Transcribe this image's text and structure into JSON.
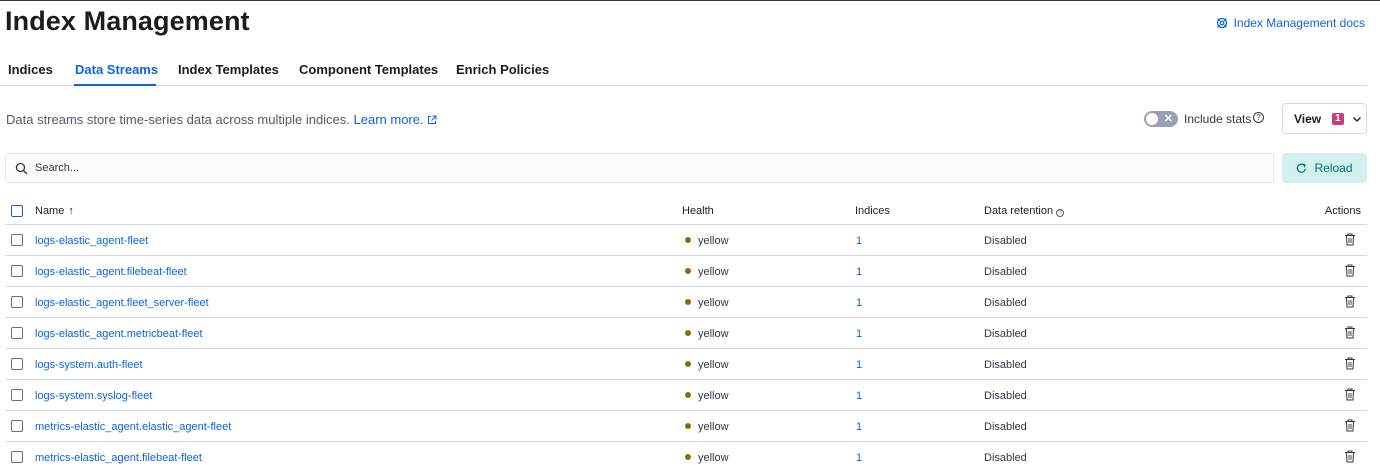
{
  "header": {
    "title": "Index Management",
    "docs_link": "Index Management docs"
  },
  "tabs": [
    {
      "label": "Indices",
      "active": false
    },
    {
      "label": "Data Streams",
      "active": true
    },
    {
      "label": "Index Templates",
      "active": false
    },
    {
      "label": "Component Templates",
      "active": false
    },
    {
      "label": "Enrich Policies",
      "active": false
    }
  ],
  "description": {
    "text": "Data streams store time-series data across multiple indices. ",
    "link": "Learn more."
  },
  "controls": {
    "include_stats_label": "Include stats",
    "include_stats_on": false,
    "view_label": "View",
    "view_badge": "1",
    "search_placeholder": "Search...",
    "reload_label": "Reload"
  },
  "table": {
    "columns": {
      "name": "Name",
      "health": "Health",
      "indices": "Indices",
      "retention": "Data retention",
      "actions": "Actions"
    },
    "rows": [
      {
        "name": "logs-elastic_agent-fleet",
        "health": "yellow",
        "indices": "1",
        "retention": "Disabled"
      },
      {
        "name": "logs-elastic_agent.filebeat-fleet",
        "health": "yellow",
        "indices": "1",
        "retention": "Disabled"
      },
      {
        "name": "logs-elastic_agent.fleet_server-fleet",
        "health": "yellow",
        "indices": "1",
        "retention": "Disabled"
      },
      {
        "name": "logs-elastic_agent.metricbeat-fleet",
        "health": "yellow",
        "indices": "1",
        "retention": "Disabled"
      },
      {
        "name": "logs-system.auth-fleet",
        "health": "yellow",
        "indices": "1",
        "retention": "Disabled"
      },
      {
        "name": "logs-system.syslog-fleet",
        "health": "yellow",
        "indices": "1",
        "retention": "Disabled"
      },
      {
        "name": "metrics-elastic_agent.elastic_agent-fleet",
        "health": "yellow",
        "indices": "1",
        "retention": "Disabled"
      },
      {
        "name": "metrics-elastic_agent.filebeat-fleet",
        "health": "yellow",
        "indices": "1",
        "retention": "Disabled"
      }
    ]
  },
  "colors": {
    "accent": "#0b64dd",
    "health_yellow": "#8a6a0a",
    "badge": "#c4407c",
    "reload_bg": "#d2f1ee",
    "reload_text": "#00756c"
  },
  "icons": {
    "docs": "docs-icon",
    "external_link": "external-link-icon",
    "help": "question-icon",
    "chevron": "chevron-down-icon",
    "search": "search-icon",
    "reload": "refresh-icon",
    "sort": "sort-ascending-icon",
    "delete": "trash-icon"
  }
}
